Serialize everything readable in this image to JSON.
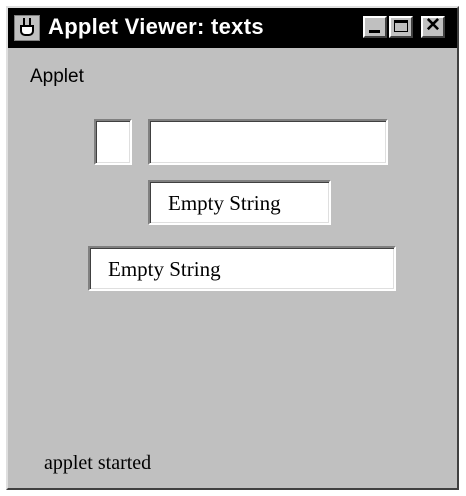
{
  "window": {
    "title": "Applet Viewer: texts",
    "icon": "java-cup-icon",
    "controls": {
      "minimize": "minimize-icon",
      "maximize": "maximize-icon",
      "close_glyph": "✕"
    }
  },
  "menu": {
    "label": "Applet"
  },
  "fields": [
    {
      "value": ""
    },
    {
      "value": ""
    },
    {
      "value": "Empty String"
    },
    {
      "value": "Empty String"
    }
  ],
  "status": {
    "text": "applet started"
  },
  "colors": {
    "titlebar": "#000000",
    "title_text": "#ffffff",
    "window_bg": "#c0c0c0",
    "field_bg": "#ffffff"
  }
}
